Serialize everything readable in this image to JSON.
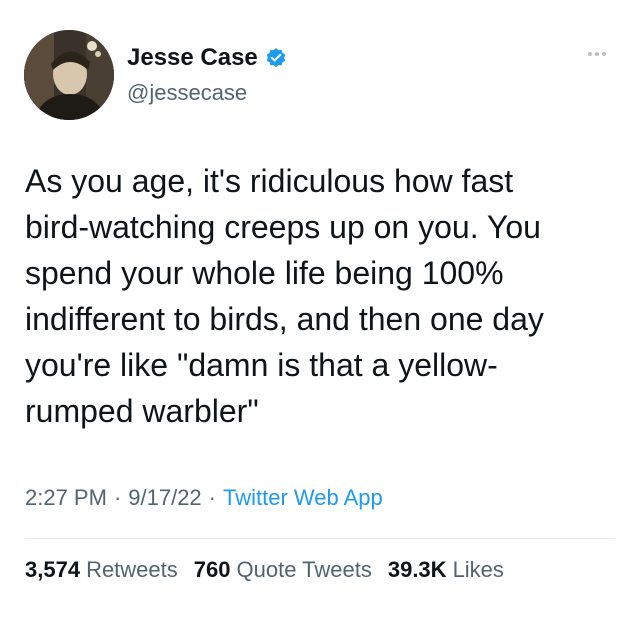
{
  "author": {
    "display_name": "Jesse Case",
    "handle": "@jessecase",
    "verified": true
  },
  "tweet": {
    "text": "As you age, it's ridiculous how fast\nbird-watching creeps up on you. You\nspend your whole life being 100%\nindifferent to birds, and then one day\nyou're like \"damn is that a yellow-\nrumped warbler\""
  },
  "meta": {
    "time": "2:27 PM",
    "date": "9/17/22",
    "source": "Twitter Web App",
    "separator": "·"
  },
  "stats": {
    "retweets_count": "3,574",
    "retweets_label": "Retweets",
    "quotes_count": "760",
    "quotes_label": "Quote Tweets",
    "likes_count": "39.3K",
    "likes_label": "Likes"
  },
  "colors": {
    "text": "#0f1419",
    "secondary": "#536471",
    "accent": "#1d9bf0"
  },
  "icons": {
    "verified": "verified-badge-icon",
    "more": "more-options-icon"
  }
}
